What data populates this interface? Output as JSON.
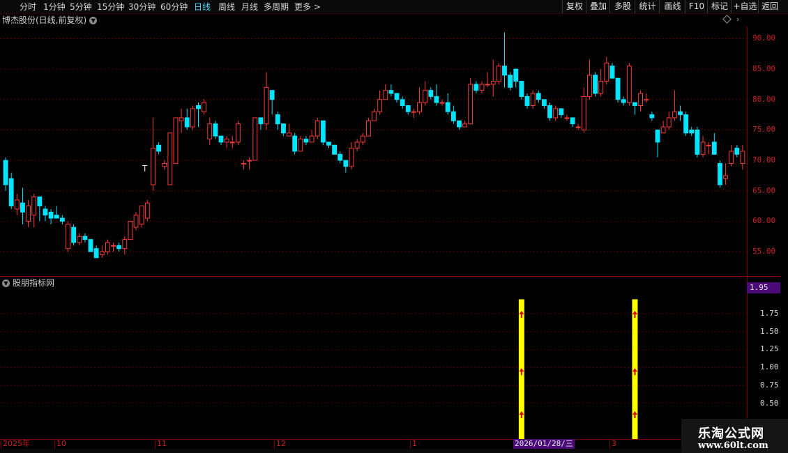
{
  "toolbar": {
    "periods": [
      "分时",
      "1分钟",
      "5分钟",
      "15分钟",
      "30分钟",
      "60分钟",
      "日线",
      "周线",
      "月线",
      "多周期",
      "更多 >"
    ],
    "active_period": "日线",
    "right_buttons": [
      "复权",
      "叠加",
      "多股",
      "统计",
      "画线",
      "F10",
      "标记",
      "+自选",
      "返回"
    ]
  },
  "chart_title": "博杰股份(日线,前复权)",
  "title_dropdown_icon": "chevron-down-icon",
  "price_axis": [
    "90.00",
    "85.00",
    "80.00",
    "75.00",
    "70.00",
    "65.00",
    "60.00",
    "55.00"
  ],
  "price_marker": "T",
  "indicator": {
    "name": "股朋指标网",
    "current_value": "1.95",
    "axis": [
      "1.75",
      "1.50",
      "1.25",
      "1.00",
      "0.75",
      "0.50"
    ]
  },
  "timeline": {
    "ticks": [
      "2025年",
      "10",
      "11",
      "12",
      "1",
      "3"
    ],
    "cursor_date": "2026/01/28/三"
  },
  "colors": {
    "up": "#ff3a3a",
    "down": "#00e5ff",
    "grid": "#5a0000",
    "signal_bar": "#ffff00",
    "signal_arrow": "#e00000",
    "cursor_bg": "#4a0a78"
  },
  "watermark": {
    "line1": "乐淘公式网",
    "line2": "www.60lt.com"
  },
  "chart_data": {
    "type": "candlestick",
    "title": "博杰股份(日线,前复权)",
    "ylim": [
      51,
      92
    ],
    "candles": [
      [
        70,
        66,
        70.5,
        65
      ],
      [
        67,
        62.5,
        68,
        62
      ],
      [
        62,
        63.5,
        64.5,
        61
      ],
      [
        63,
        61.5,
        65.5,
        59.5
      ],
      [
        60,
        62.5,
        63.5,
        59
      ],
      [
        61,
        64,
        64.5,
        59
      ],
      [
        64,
        62.5,
        64,
        60
      ],
      [
        62,
        61,
        62.5,
        60
      ],
      [
        61.5,
        60.5,
        62,
        59.5
      ],
      [
        61,
        60.5,
        62.5,
        60.5
      ],
      [
        60.5,
        60,
        61,
        59.5
      ],
      [
        55.5,
        59.5,
        60,
        55
      ],
      [
        59,
        56.5,
        59.5,
        56
      ],
      [
        56.5,
        57.5,
        58,
        56
      ],
      [
        57.5,
        57,
        58,
        56.5
      ],
      [
        57,
        55,
        57,
        55
      ],
      [
        55.5,
        54,
        56,
        54
      ],
      [
        54.5,
        55,
        56,
        54
      ],
      [
        55,
        56.5,
        57,
        54.5
      ],
      [
        56,
        56,
        56.5,
        55
      ],
      [
        56,
        55.5,
        56.5,
        55
      ],
      [
        55.5,
        57,
        57.5,
        54.5
      ],
      [
        57,
        60,
        60,
        57
      ],
      [
        59,
        61,
        61.5,
        58.5
      ],
      [
        59.5,
        62.5,
        62.5,
        59
      ],
      [
        60.5,
        63,
        63.5,
        60
      ],
      [
        66,
        72,
        77,
        65
      ],
      [
        72.5,
        71.5,
        73,
        71
      ],
      [
        69,
        69.5,
        70,
        68.5
      ],
      [
        66,
        74.5,
        74.5,
        66
      ],
      [
        69.5,
        77,
        77,
        69.5
      ],
      [
        76.5,
        77,
        78.5,
        74.5
      ],
      [
        77,
        75.5,
        78.5,
        75
      ],
      [
        75.5,
        78.5,
        79,
        75
      ],
      [
        79,
        78.5,
        79.5,
        75.5
      ],
      [
        78,
        79.5,
        80,
        77.5
      ],
      [
        73.5,
        76,
        77,
        72.5
      ],
      [
        76,
        74,
        76.5,
        73.5
      ],
      [
        74,
        73,
        74,
        72.5
      ],
      [
        73,
        73.5,
        74,
        72
      ],
      [
        73,
        73,
        74,
        72
      ],
      [
        73,
        76,
        76.5,
        72.5
      ],
      [
        69.5,
        69.5,
        70,
        68.5
      ],
      [
        70,
        70,
        70.5,
        68.5
      ],
      [
        70,
        77,
        77,
        70
      ],
      [
        77,
        76,
        77,
        75
      ],
      [
        76,
        82,
        84.5,
        75
      ],
      [
        81.5,
        80,
        81.5,
        77.5
      ],
      [
        77.5,
        76,
        78,
        75
      ],
      [
        76,
        74.5,
        76,
        74
      ],
      [
        74,
        74.5,
        76,
        74
      ],
      [
        74,
        71.5,
        74.5,
        71
      ],
      [
        71.5,
        73.5,
        74,
        72
      ],
      [
        73.5,
        73,
        74,
        72.5
      ],
      [
        73,
        74,
        75,
        73
      ],
      [
        74,
        76.5,
        77,
        73.5
      ],
      [
        76.5,
        73,
        76.5,
        72.5
      ],
      [
        73,
        72.5,
        73,
        72
      ],
      [
        72.5,
        71,
        72.5,
        71
      ],
      [
        71,
        70,
        71.5,
        69.5
      ],
      [
        70,
        69,
        70,
        68
      ],
      [
        69,
        72,
        73,
        68.5
      ],
      [
        72,
        73,
        73.5,
        71.5
      ],
      [
        73,
        74,
        74.5,
        72.5
      ],
      [
        74,
        76.5,
        77,
        74
      ],
      [
        76.5,
        78,
        78.5,
        76.5
      ],
      [
        78,
        80,
        81.5,
        77.5
      ],
      [
        80,
        81.5,
        82.5,
        80
      ],
      [
        81.5,
        81,
        82.5,
        80.5
      ],
      [
        81,
        80,
        81,
        79.5
      ],
      [
        80,
        79,
        80.5,
        78.5
      ],
      [
        79,
        78,
        79,
        77.5
      ],
      [
        78,
        78,
        78.5,
        77
      ],
      [
        78,
        79.5,
        82,
        77.5
      ],
      [
        79.5,
        81.5,
        83,
        79
      ],
      [
        81.5,
        80.5,
        82,
        80
      ],
      [
        80.5,
        79.5,
        82.5,
        79
      ],
      [
        79.5,
        79.5,
        80,
        79
      ],
      [
        79.5,
        78,
        81,
        77.5
      ],
      [
        78,
        76.5,
        79,
        76
      ],
      [
        76.5,
        75.5,
        76.5,
        75
      ],
      [
        75.5,
        76,
        76.5,
        75.5
      ],
      [
        76,
        82.5,
        83.5,
        76
      ],
      [
        82.5,
        81.5,
        83,
        81
      ],
      [
        81.5,
        82.5,
        83,
        81
      ],
      [
        82.5,
        82.5,
        84.5,
        82
      ],
      [
        82.5,
        83,
        86.5,
        80.5
      ],
      [
        83,
        85.5,
        86,
        82.5
      ],
      [
        85.5,
        84,
        91,
        82
      ],
      [
        84,
        82,
        84.5,
        81.5
      ],
      [
        85,
        83,
        85,
        82
      ],
      [
        83,
        80.5,
        83,
        80
      ],
      [
        80.5,
        79,
        81,
        78.5
      ],
      [
        79,
        81,
        81.5,
        78.5
      ],
      [
        81,
        80,
        81.5,
        79.5
      ],
      [
        80,
        79,
        80,
        78.5
      ],
      [
        79,
        77,
        79.5,
        76.5
      ],
      [
        77,
        78.5,
        79,
        76.5
      ],
      [
        78.5,
        77.5,
        78.5,
        77
      ],
      [
        77,
        77,
        77.5,
        76.5
      ],
      [
        77,
        76,
        77,
        75.5
      ],
      [
        75.5,
        75.5,
        76,
        75
      ],
      [
        75,
        80.5,
        82,
        74.5
      ],
      [
        80.5,
        84,
        86.5,
        80
      ],
      [
        84,
        81,
        84.5,
        80.5
      ],
      [
        81,
        83,
        85,
        80.5
      ],
      [
        83,
        86,
        87,
        82.5
      ],
      [
        85.5,
        83.5,
        86,
        83.5
      ],
      [
        83.5,
        80,
        83.5,
        79.5
      ],
      [
        80,
        79.5,
        80.5,
        79
      ],
      [
        79.5,
        85.5,
        86,
        79
      ],
      [
        79.5,
        79,
        79.5,
        77.5
      ],
      [
        79,
        81,
        81.5,
        78
      ],
      [
        80,
        80,
        81,
        79.5
      ],
      [
        77.5,
        77,
        78,
        76.5
      ],
      [
        75,
        73,
        75,
        70.5
      ],
      [
        74.5,
        75.5,
        76.5,
        74.5
      ],
      [
        75.5,
        77,
        78,
        75
      ],
      [
        77,
        78,
        81.5,
        76.5
      ],
      [
        78,
        77.5,
        79,
        76.5
      ],
      [
        77.5,
        74.5,
        78,
        74
      ],
      [
        75,
        74.5,
        75.5,
        74
      ],
      [
        75,
        71,
        75.5,
        70.5
      ],
      [
        71,
        73,
        74,
        70.5
      ],
      [
        72.5,
        72.5,
        73,
        71
      ],
      [
        73,
        71,
        74.5,
        71
      ],
      [
        69.5,
        66,
        70,
        65.5
      ],
      [
        67,
        67.5,
        69.5,
        66
      ],
      [
        69.5,
        71.5,
        72.5,
        69
      ],
      [
        72,
        71,
        72.5,
        70.5
      ],
      [
        69.5,
        71.5,
        72.5,
        68.5
      ]
    ],
    "indicator_signals": [
      {
        "candle_index": 91,
        "height": 1.95,
        "arrows": [
          1.75,
          0.95,
          0.35
        ]
      },
      {
        "candle_index": 111,
        "height": 1.95,
        "arrows": [
          1.75,
          0.95,
          0.35
        ]
      }
    ],
    "indicator_ylim": [
      0,
      2.1
    ]
  }
}
